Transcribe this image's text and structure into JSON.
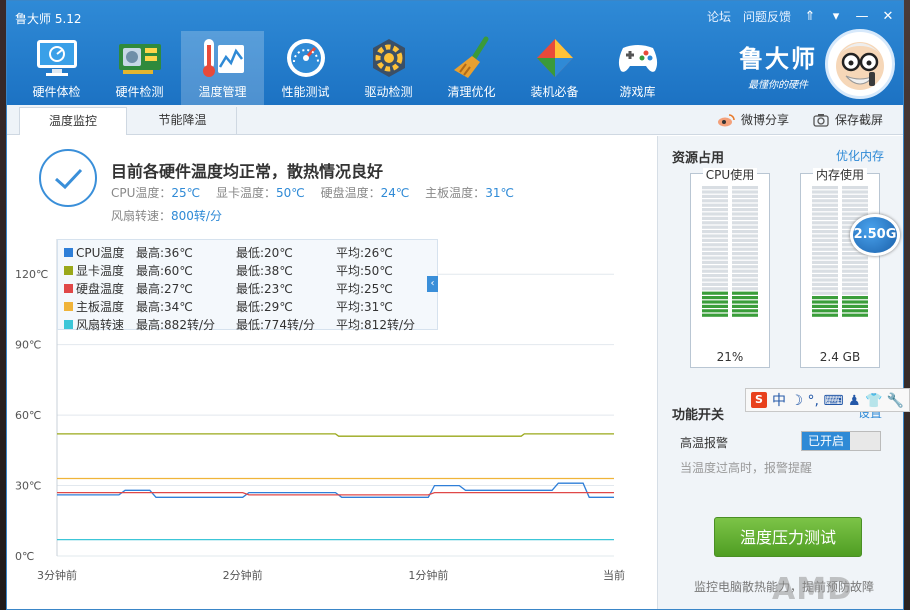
{
  "window": {
    "title": "鲁大师 5.12",
    "top_links": [
      "论坛",
      "问题反馈"
    ],
    "controls": [
      "⇑",
      "▾",
      "—",
      "✕"
    ]
  },
  "nav": [
    {
      "label": "硬件体检",
      "icon": "monitor-icon"
    },
    {
      "label": "硬件检测",
      "icon": "graphics-card-icon"
    },
    {
      "label": "温度管理",
      "icon": "thermometer-icon",
      "active": true
    },
    {
      "label": "性能测试",
      "icon": "speedometer-icon"
    },
    {
      "label": "驱动检测",
      "icon": "driver-gear-icon"
    },
    {
      "label": "清理优化",
      "icon": "broom-icon"
    },
    {
      "label": "装机必备",
      "icon": "software-box-icon"
    },
    {
      "label": "游戏库",
      "icon": "gamepad-icon"
    }
  ],
  "brand": {
    "name": "鲁大师",
    "slogan": "最懂你的硬件"
  },
  "tabs": [
    {
      "label": "温度监控",
      "active": true
    },
    {
      "label": "节能降温"
    }
  ],
  "share": {
    "weibo": "微博分享",
    "screenshot": "保存截屏"
  },
  "status": {
    "title": "目前各硬件温度均正常，散热情况良好",
    "readings": [
      {
        "label": "CPU温度：",
        "value": "25℃"
      },
      {
        "label": "显卡温度：",
        "value": "50℃"
      },
      {
        "label": "硬盘温度：",
        "value": "24℃"
      },
      {
        "label": "主板温度：",
        "value": "31℃"
      }
    ],
    "fan": {
      "label": "风扇转速：",
      "value": "800转/分"
    }
  },
  "legend": [
    {
      "name": "CPU温度",
      "color": "#2f7fd8",
      "max": "最高:36℃",
      "min": "最低:20℃",
      "avg": "平均:26℃"
    },
    {
      "name": "显卡温度",
      "color": "#9aa81a",
      "max": "最高:60℃",
      "min": "最低:38℃",
      "avg": "平均:50℃"
    },
    {
      "name": "硬盘温度",
      "color": "#e04848",
      "max": "最高:27℃",
      "min": "最低:23℃",
      "avg": "平均:25℃"
    },
    {
      "name": "主板温度",
      "color": "#f0b43a",
      "max": "最高:34℃",
      "min": "最低:29℃",
      "avg": "平均:31℃"
    },
    {
      "name": "风扇转速",
      "color": "#3cc6d8",
      "max": "最高:882转/分",
      "min": "最低:774转/分",
      "avg": "平均:812转/分"
    }
  ],
  "chart_data": {
    "type": "line",
    "x": [
      "3分钟前",
      "2分钟前",
      "1分钟前",
      "当前"
    ],
    "xrange": [
      -180,
      0
    ],
    "yticks": [
      "0℃",
      "30℃",
      "60℃",
      "90℃",
      "120℃"
    ],
    "ylim": [
      0,
      135
    ],
    "grid": true,
    "legend_position": "top-left",
    "series": [
      {
        "name": "显卡温度",
        "color": "#9aa81a",
        "points": [
          [
            -180,
            52
          ],
          [
            -90,
            52
          ],
          [
            -89,
            51
          ],
          [
            -30,
            51
          ],
          [
            -29,
            52
          ],
          [
            0,
            52
          ]
        ]
      },
      {
        "name": "主板温度",
        "color": "#f0b43a",
        "points": [
          [
            -180,
            33
          ],
          [
            0,
            33
          ]
        ]
      },
      {
        "name": "CPU温度",
        "color": "#2f7fd8",
        "points": [
          [
            -180,
            26
          ],
          [
            -160,
            26
          ],
          [
            -158,
            28
          ],
          [
            -150,
            28
          ],
          [
            -148,
            25
          ],
          [
            -120,
            25
          ],
          [
            -118,
            27
          ],
          [
            -90,
            27
          ],
          [
            -88,
            25
          ],
          [
            -60,
            25
          ],
          [
            -58,
            30
          ],
          [
            -50,
            30
          ],
          [
            -48,
            28
          ],
          [
            -20,
            28
          ],
          [
            -18,
            31
          ],
          [
            -10,
            31
          ],
          [
            -8,
            25
          ],
          [
            0,
            25
          ]
        ]
      },
      {
        "name": "硬盘温度",
        "color": "#e04848",
        "points": [
          [
            -180,
            27
          ],
          [
            -120,
            27
          ],
          [
            -118,
            26
          ],
          [
            -60,
            26
          ],
          [
            -58,
            27
          ],
          [
            0,
            27
          ]
        ]
      },
      {
        "name": "风扇转速",
        "color": "#3cc6d8",
        "points": [
          [
            -180,
            7
          ],
          [
            0,
            7
          ]
        ]
      }
    ]
  },
  "sidebar": {
    "resources_title": "资源占用",
    "optimize_link": "优化内存",
    "cpu": {
      "label": "CPU使用",
      "value": "21%",
      "fraction": 0.21
    },
    "mem": {
      "label": "内存使用",
      "value": "2.4 GB",
      "fraction": 0.17,
      "bubble": "2.50G"
    },
    "functions_title": "功能开关",
    "settings_link": "设置",
    "alarm": {
      "label": "高温报警",
      "state": "已开启",
      "hint": "当温度过高时，报警提醒"
    },
    "stress_button": "温度压力测试",
    "footer_text": "监控电脑散热能力，提前预防故障"
  },
  "ime": {
    "chars": "中 ☽ °, ⌨ ♟ 👕 🔧"
  },
  "watermark": "AMD"
}
